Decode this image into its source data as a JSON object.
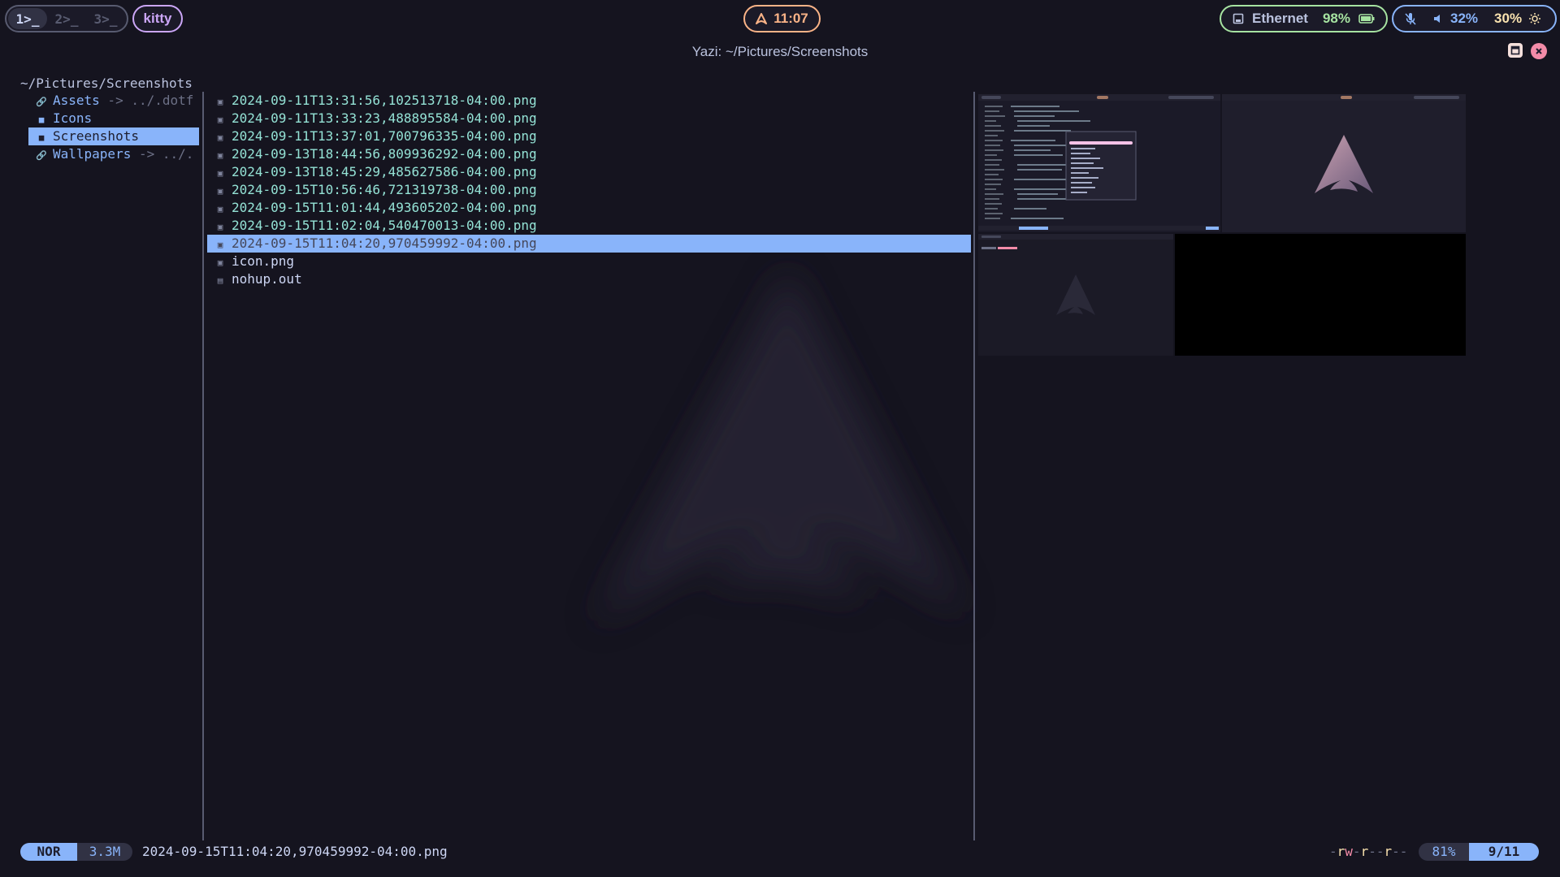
{
  "colors": {
    "background": "#15141f",
    "accent": "#89b4fa",
    "teal": "#94e2d5",
    "green": "#a6e3a1",
    "peach": "#fab387",
    "mauve": "#cba6f7",
    "red": "#f38ba8"
  },
  "topbar": {
    "workspaces": [
      {
        "label": "1>_",
        "active": true
      },
      {
        "label": "2>_",
        "active": false
      },
      {
        "label": "3>_",
        "active": false
      }
    ],
    "app": "kitty",
    "clock": "11:07",
    "network": {
      "label": "Ethernet",
      "icon": "ethernet-icon"
    },
    "battery": {
      "percent": "98%",
      "icon": "battery-icon"
    },
    "mic_icon": "mic-muted-icon",
    "volume": {
      "percent": "32%",
      "icon": "speaker-icon"
    },
    "brightness": {
      "percent": "30%",
      "icon": "sun-icon"
    }
  },
  "window": {
    "title": "Yazi: ~/Pictures/Screenshots"
  },
  "yazi": {
    "path": "~/Pictures/Screenshots",
    "parent_items": [
      {
        "name": "Assets",
        "link": " -> ../.dotf",
        "icon": "link-icon",
        "selected": false
      },
      {
        "name": "Icons",
        "link": "",
        "icon": "folder-icon",
        "selected": false
      },
      {
        "name": "Screenshots",
        "link": "",
        "icon": "folder-icon",
        "selected": true
      },
      {
        "name": "Wallpapers",
        "link": " -> ../.",
        "icon": "link-icon",
        "selected": false
      }
    ],
    "files": [
      {
        "name": "2024-09-11T13:31:56,102513718-04:00.png",
        "icon": "image-icon",
        "selected": false
      },
      {
        "name": "2024-09-11T13:33:23,488895584-04:00.png",
        "icon": "image-icon",
        "selected": false
      },
      {
        "name": "2024-09-11T13:37:01,700796335-04:00.png",
        "icon": "image-icon",
        "selected": false
      },
      {
        "name": "2024-09-13T18:44:56,809936292-04:00.png",
        "icon": "image-icon",
        "selected": false
      },
      {
        "name": "2024-09-13T18:45:29,485627586-04:00.png",
        "icon": "image-icon",
        "selected": false
      },
      {
        "name": "2024-09-15T10:56:46,721319738-04:00.png",
        "icon": "image-icon",
        "selected": false
      },
      {
        "name": "2024-09-15T11:01:44,493605202-04:00.png",
        "icon": "image-icon",
        "selected": false
      },
      {
        "name": "2024-09-15T11:02:04,540470013-04:00.png",
        "icon": "image-icon",
        "selected": false
      },
      {
        "name": "2024-09-15T11:04:20,970459992-04:00.png",
        "icon": "image-icon",
        "selected": true
      },
      {
        "name": "icon.png",
        "icon": "image-icon",
        "selected": false
      },
      {
        "name": "nohup.out",
        "icon": "file-icon",
        "selected": false
      }
    ],
    "status": {
      "mode": "NOR",
      "size": "3.3M",
      "filename": "2024-09-15T11:04:20,970459992-04:00.png",
      "permissions": "-rw-r--r--",
      "percent": "81%",
      "position": "9/11"
    }
  }
}
